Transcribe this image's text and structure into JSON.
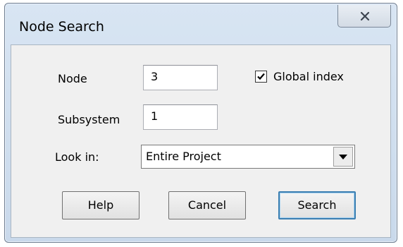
{
  "window": {
    "title": "Node Search"
  },
  "titlebar": {
    "close_icon": "close-x-icon"
  },
  "form": {
    "node_label": "Node",
    "node_value": "3",
    "subsystem_label": "Subsystem",
    "subsystem_value": "1",
    "global_index_label": "Global index",
    "global_index_checked": true,
    "look_in_label": "Look in:",
    "look_in_value": "Entire Project"
  },
  "buttons": {
    "help": "Help",
    "cancel": "Cancel",
    "search": "Search"
  }
}
